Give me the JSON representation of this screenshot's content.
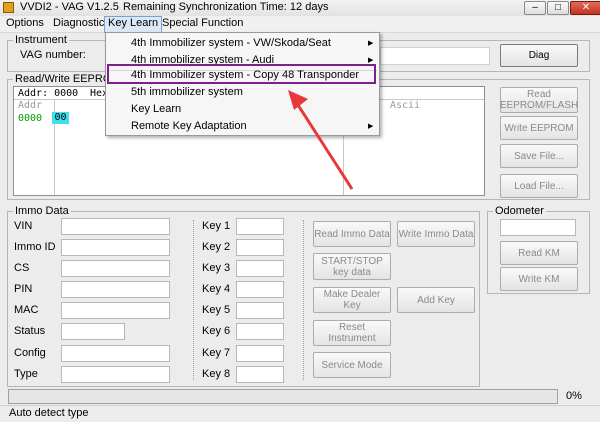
{
  "window": {
    "title": "VVDI2 - VAG V1.2.5",
    "sync": "Remaining Synchronization Time: 12 days",
    "minimize_glyph": "–",
    "maximize_glyph": "□",
    "close_glyph": "✕"
  },
  "menu": {
    "items": [
      {
        "label": "Options"
      },
      {
        "label": "Diagnostic"
      },
      {
        "label": "Key Learn"
      },
      {
        "label": "Special Function"
      }
    ],
    "dropdown": [
      {
        "label": "4th Immobilizer system - VW/Skoda/Seat",
        "submenu": true
      },
      {
        "label": "4th immobilizer system - Audi",
        "submenu": true
      },
      {
        "label": "4th Immobilizer system - Copy 48 Transponder",
        "submenu": false
      },
      {
        "label": "5th immobilizer system",
        "submenu": false
      },
      {
        "label": "Key Learn",
        "submenu": false
      },
      {
        "label": "Remote Key Adaptation",
        "submenu": true
      }
    ],
    "arrow_glyph": "▶"
  },
  "instrument": {
    "group_label": "Instrument",
    "vag_number_label": "VAG number:",
    "diag_button": "Diag"
  },
  "eeprom": {
    "group_label": "Read/Write EEPROM",
    "addr_label": "Addr: 0000",
    "hex_label": "Hex",
    "header_addr": "Addr",
    "header_ascii": "Ascii",
    "row_addr": "0000",
    "row_value": "00",
    "buttons": {
      "read": "Read EEPROM/FLASH",
      "write": "Write EEPROM",
      "save": "Save File...",
      "load": "Load File..."
    }
  },
  "immo": {
    "group_label": "Immo Data",
    "fields": [
      "VIN",
      "Immo ID",
      "CS",
      "PIN",
      "MAC",
      "Status",
      "Config",
      "Type"
    ],
    "keys": [
      "Key 1",
      "Key 2",
      "Key 3",
      "Key 4",
      "Key 5",
      "Key 6",
      "Key 7",
      "Key 8"
    ],
    "buttons": {
      "read_immo": "Read Immo Data",
      "write_immo": "Write Immo Data",
      "start_stop": "START/STOP key data",
      "make_dealer": "Make Dealer Key",
      "add_key": "Add Key",
      "reset_instrument": "Reset Instrument",
      "service_mode": "Service Mode"
    }
  },
  "odometer": {
    "group_label": "Odometer",
    "read_km": "Read KM",
    "write_km": "Write KM"
  },
  "progress": {
    "value": 0,
    "percent_text": "0%"
  },
  "status_bar": {
    "text": "Auto detect type"
  },
  "colors": {
    "highlight_box": "#7d1f8f",
    "annotation_arrow": "#e8383a",
    "addr_text": "#00a000",
    "cell_highlight": "#3fe0ea"
  }
}
